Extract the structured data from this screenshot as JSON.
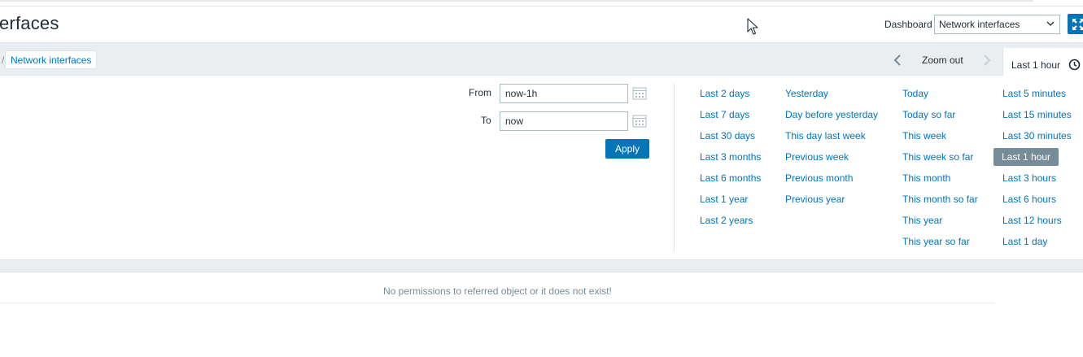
{
  "header": {
    "title": "erfaces",
    "dashboard_label": "Dashboard",
    "dashboard_selected": "Network interfaces"
  },
  "breadcrumb": {
    "separator": "/",
    "current": "Network interfaces"
  },
  "timeline": {
    "zoom_out": "Zoom out",
    "active_period": "Last 1 hour"
  },
  "time_selector": {
    "from_label": "From",
    "from_value": "now-1h",
    "to_label": "To",
    "to_value": "now",
    "apply_label": "Apply",
    "columns": [
      [
        "Last 2 days",
        "Last 7 days",
        "Last 30 days",
        "Last 3 months",
        "Last 6 months",
        "Last 1 year",
        "Last 2 years"
      ],
      [
        "Yesterday",
        "Day before yesterday",
        "This day last week",
        "Previous week",
        "Previous month",
        "Previous year"
      ],
      [
        "Today",
        "Today so far",
        "This week",
        "This week so far",
        "This month",
        "This month so far",
        "This year",
        "This year so far"
      ],
      [
        "Last 5 minutes",
        "Last 15 minutes",
        "Last 30 minutes",
        "Last 1 hour",
        "Last 3 hours",
        "Last 6 hours",
        "Last 12 hours",
        "Last 1 day"
      ]
    ],
    "active": "Last 1 hour"
  },
  "message": {
    "no_permissions": "No permissions to referred object or it does not exist!"
  },
  "colors": {
    "accent": "#0275b8",
    "active_bg": "#768d99",
    "band": "#ebeef0"
  }
}
